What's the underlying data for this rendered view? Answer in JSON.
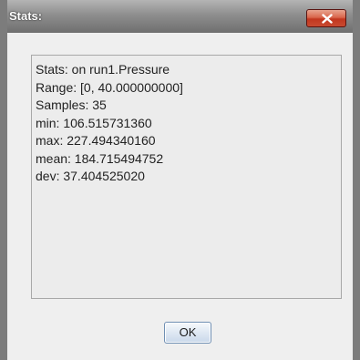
{
  "window": {
    "title": "Stats:",
    "close_icon": "close-x-icon"
  },
  "stats": {
    "lines": [
      "Stats: on run1.Pressure",
      "Range: [0, 40.000000000]",
      "Samples: 35",
      "min: 106.515731360",
      "max: 227.494340160",
      "mean: 184.715494752",
      "dev: 37.404525020"
    ]
  },
  "buttons": {
    "ok_label": "OK"
  },
  "colors": {
    "close_button": "#c84a30",
    "titlebar": "#8e8e8e",
    "ok_border": "#6f8fb3"
  }
}
